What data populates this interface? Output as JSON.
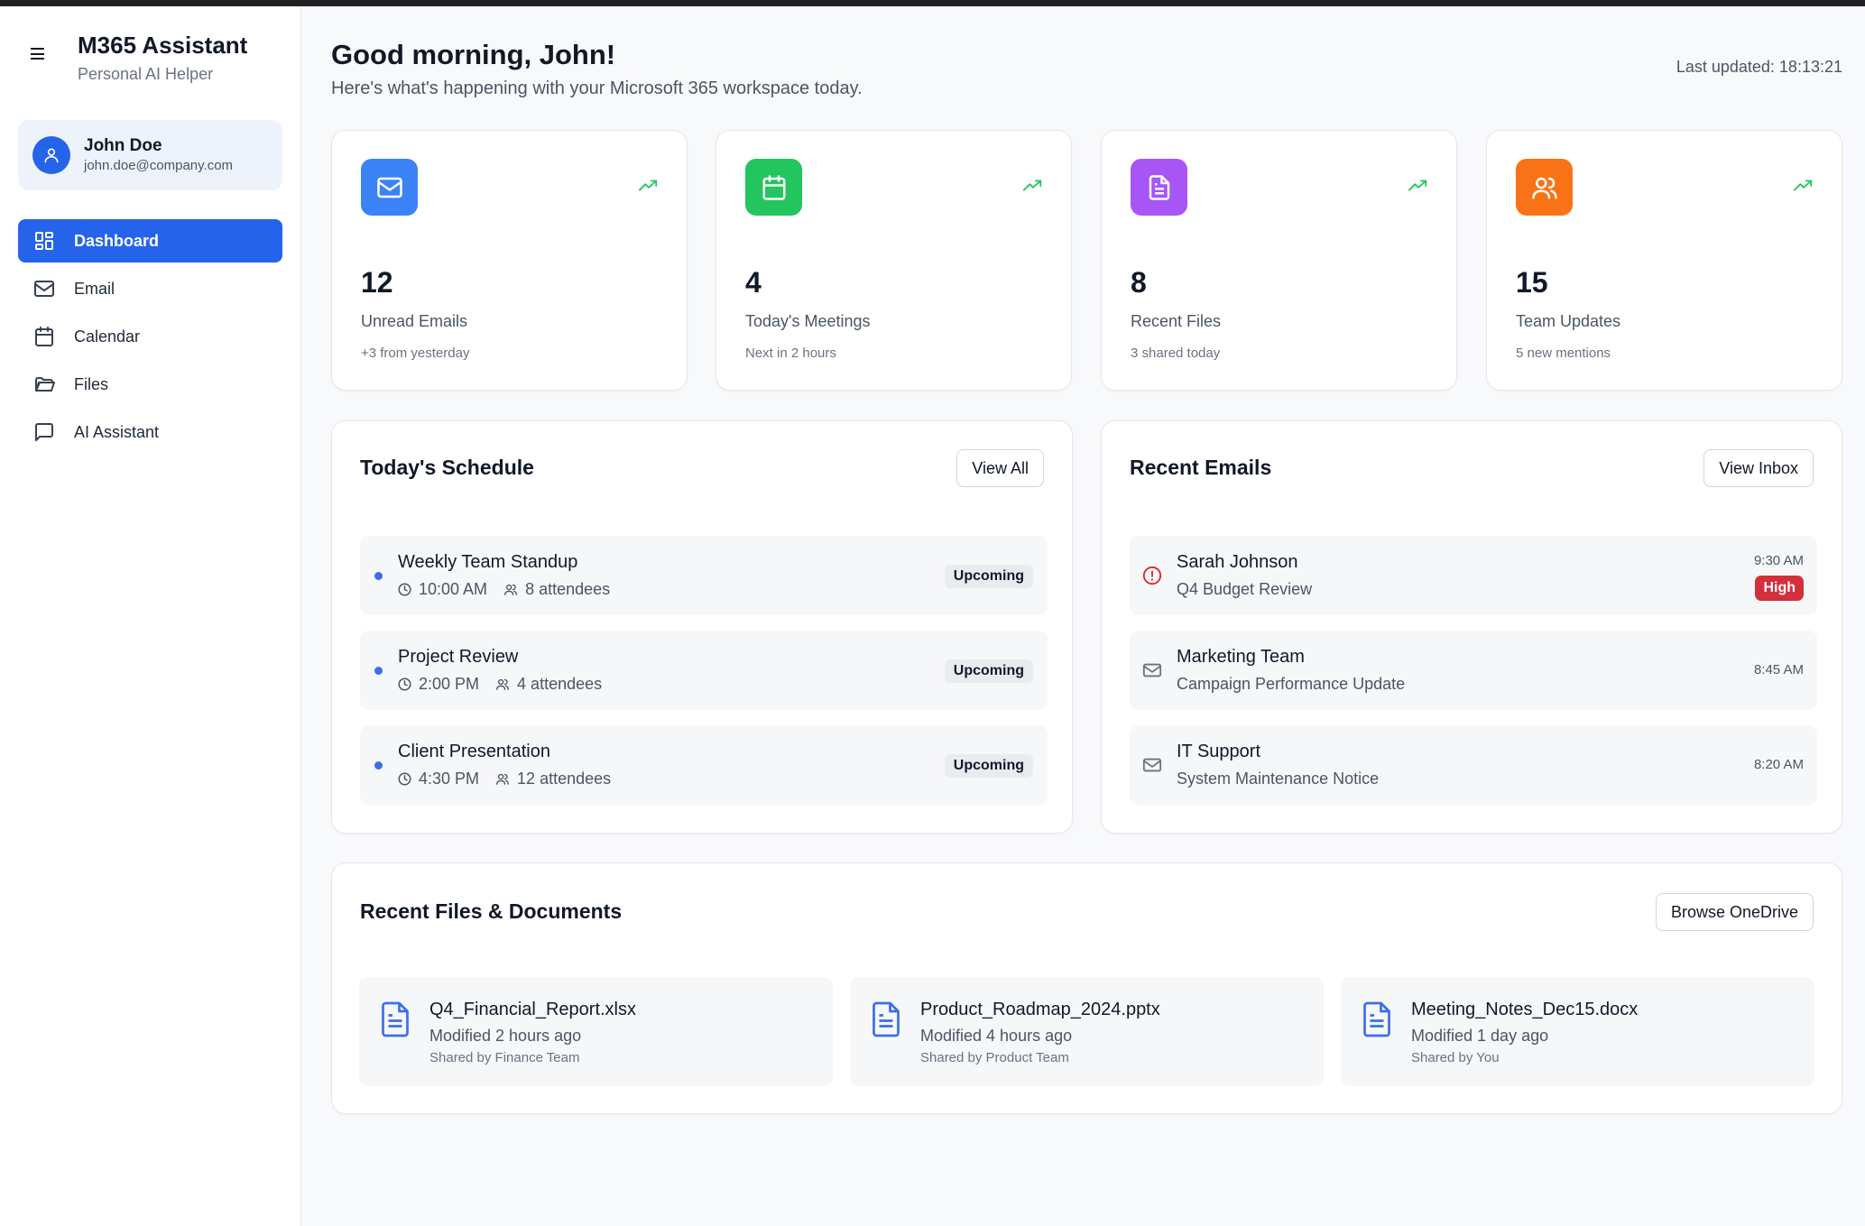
{
  "app": {
    "title": "M365 Assistant",
    "subtitle": "Personal AI Helper"
  },
  "user": {
    "name": "John Doe",
    "email": "john.doe@company.com"
  },
  "nav": [
    {
      "label": "Dashboard",
      "icon": "dashboard-icon",
      "active": true
    },
    {
      "label": "Email",
      "icon": "mail-icon",
      "active": false
    },
    {
      "label": "Calendar",
      "icon": "calendar-icon",
      "active": false
    },
    {
      "label": "Files",
      "icon": "folder-icon",
      "active": false
    },
    {
      "label": "AI Assistant",
      "icon": "chat-icon",
      "active": false
    }
  ],
  "header": {
    "greeting": "Good morning, John!",
    "subheading": "Here's what's happening with your Microsoft 365 workspace today.",
    "last_updated": "Last updated: 18:13:21"
  },
  "stats": [
    {
      "value": "12",
      "label": "Unread Emails",
      "sub": "+3 from yesterday",
      "icon": "mail-icon",
      "color": "#3b82f6"
    },
    {
      "value": "4",
      "label": "Today's Meetings",
      "sub": "Next in 2 hours",
      "icon": "calendar-icon",
      "color": "#22c55e"
    },
    {
      "value": "8",
      "label": "Recent Files",
      "sub": "3 shared today",
      "icon": "document-icon",
      "color": "#a855f7"
    },
    {
      "value": "15",
      "label": "Team Updates",
      "sub": "5 new mentions",
      "icon": "users-icon",
      "color": "#f97316"
    }
  ],
  "schedule": {
    "title": "Today's Schedule",
    "button": "View All",
    "items": [
      {
        "title": "Weekly Team Standup",
        "time": "10:00 AM",
        "attendees": "8 attendees",
        "status": "Upcoming"
      },
      {
        "title": "Project Review",
        "time": "2:00 PM",
        "attendees": "4 attendees",
        "status": "Upcoming"
      },
      {
        "title": "Client Presentation",
        "time": "4:30 PM",
        "attendees": "12 attendees",
        "status": "Upcoming"
      }
    ]
  },
  "emails": {
    "title": "Recent Emails",
    "button": "View Inbox",
    "items": [
      {
        "sender": "Sarah Johnson",
        "subject": "Q4 Budget Review",
        "time": "9:30 AM",
        "priority": "High",
        "icon": "alert-circle-icon"
      },
      {
        "sender": "Marketing Team",
        "subject": "Campaign Performance Update",
        "time": "8:45 AM",
        "icon": "mail-icon"
      },
      {
        "sender": "IT Support",
        "subject": "System Maintenance Notice",
        "time": "8:20 AM",
        "icon": "mail-icon"
      }
    ]
  },
  "files": {
    "title": "Recent Files & Documents",
    "button": "Browse OneDrive",
    "items": [
      {
        "name": "Q4_Financial_Report.xlsx",
        "modified": "Modified 2 hours ago",
        "shared": "Shared by Finance Team"
      },
      {
        "name": "Product_Roadmap_2024.pptx",
        "modified": "Modified 4 hours ago",
        "shared": "Shared by Product Team"
      },
      {
        "name": "Meeting_Notes_Dec15.docx",
        "modified": "Modified 1 day ago",
        "shared": "Shared by You"
      }
    ]
  },
  "colors": {
    "accent": "#2563eb",
    "danger": "#d32f3c",
    "trend": "#22c55e"
  }
}
